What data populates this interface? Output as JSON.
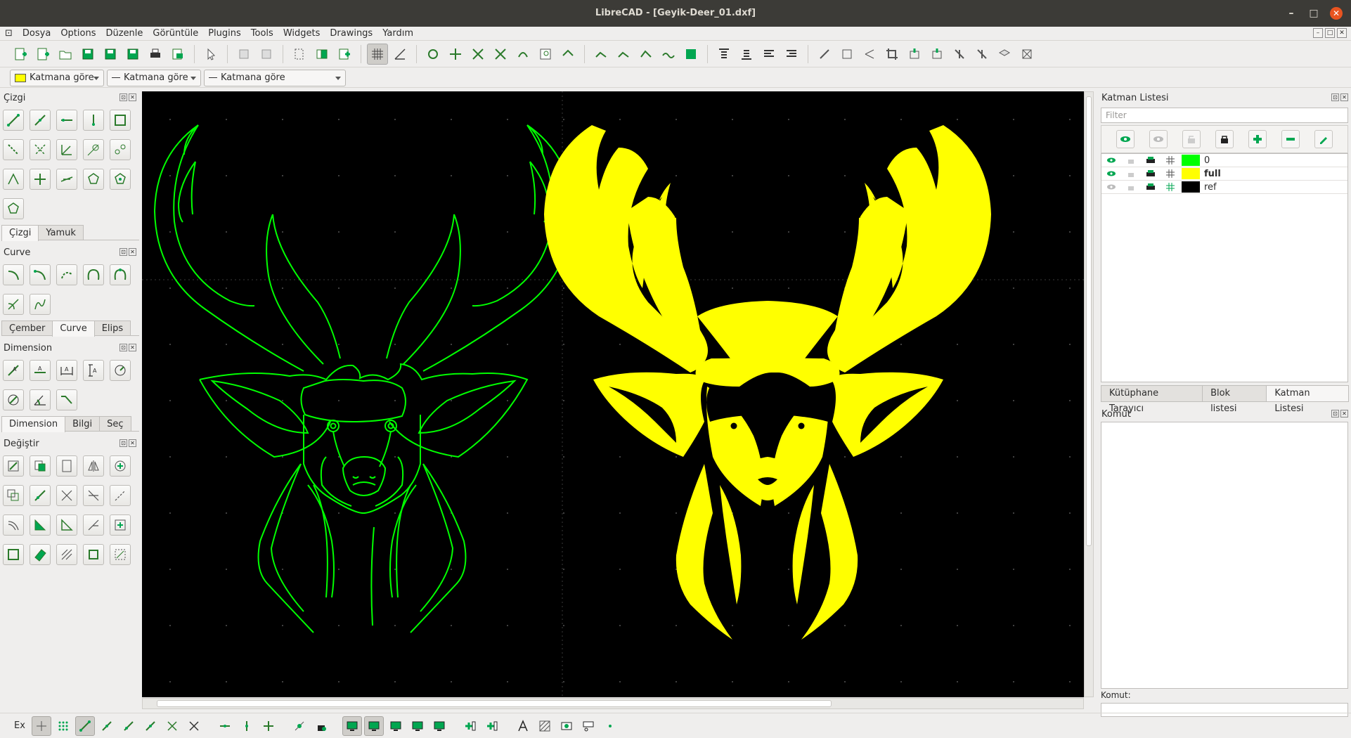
{
  "window": {
    "title": "LibreCAD - [Geyik-Deer_01.dxf]",
    "minimize": "–",
    "maximize": "□",
    "close": "✕"
  },
  "menu": [
    "Dosya",
    "Options",
    "Düzenle",
    "Görüntüle",
    "Plugins",
    "Tools",
    "Widgets",
    "Drawings",
    "Yardım"
  ],
  "pen": {
    "color_label": "Katmana göre",
    "color": "#ffff00",
    "width_label": "Katmana göre",
    "type_label": "Katmana göre"
  },
  "left": {
    "line_title": "Çizgi",
    "line_tabs": [
      "Çizgi",
      "Yamuk"
    ],
    "curve_title": "Curve",
    "curve_tabs": [
      "Çember",
      "Curve",
      "Elips"
    ],
    "dim_title": "Dimension",
    "dim_tabs": [
      "Dimension",
      "Bilgi",
      "Seç"
    ],
    "modify_title": "Değiştir"
  },
  "right": {
    "layer_title": "Katman Listesi",
    "filter_placeholder": "Filter",
    "layers": [
      {
        "name": "0",
        "color": "#00ff00",
        "bold": false
      },
      {
        "name": "full",
        "color": "#ffff00",
        "bold": true
      },
      {
        "name": "ref",
        "color": "#000000",
        "bold": false
      }
    ],
    "tabs": [
      "Kütüphane Tarayıcı",
      "Blok listesi",
      "Katman Listesi"
    ],
    "command_title": "Komut",
    "command_label": "Komut:"
  },
  "status": {
    "ex": "Ex"
  },
  "colors": {
    "outline": "#00ff00",
    "fill": "#ffff00",
    "canvas": "#000000",
    "accent": "#00a650"
  }
}
